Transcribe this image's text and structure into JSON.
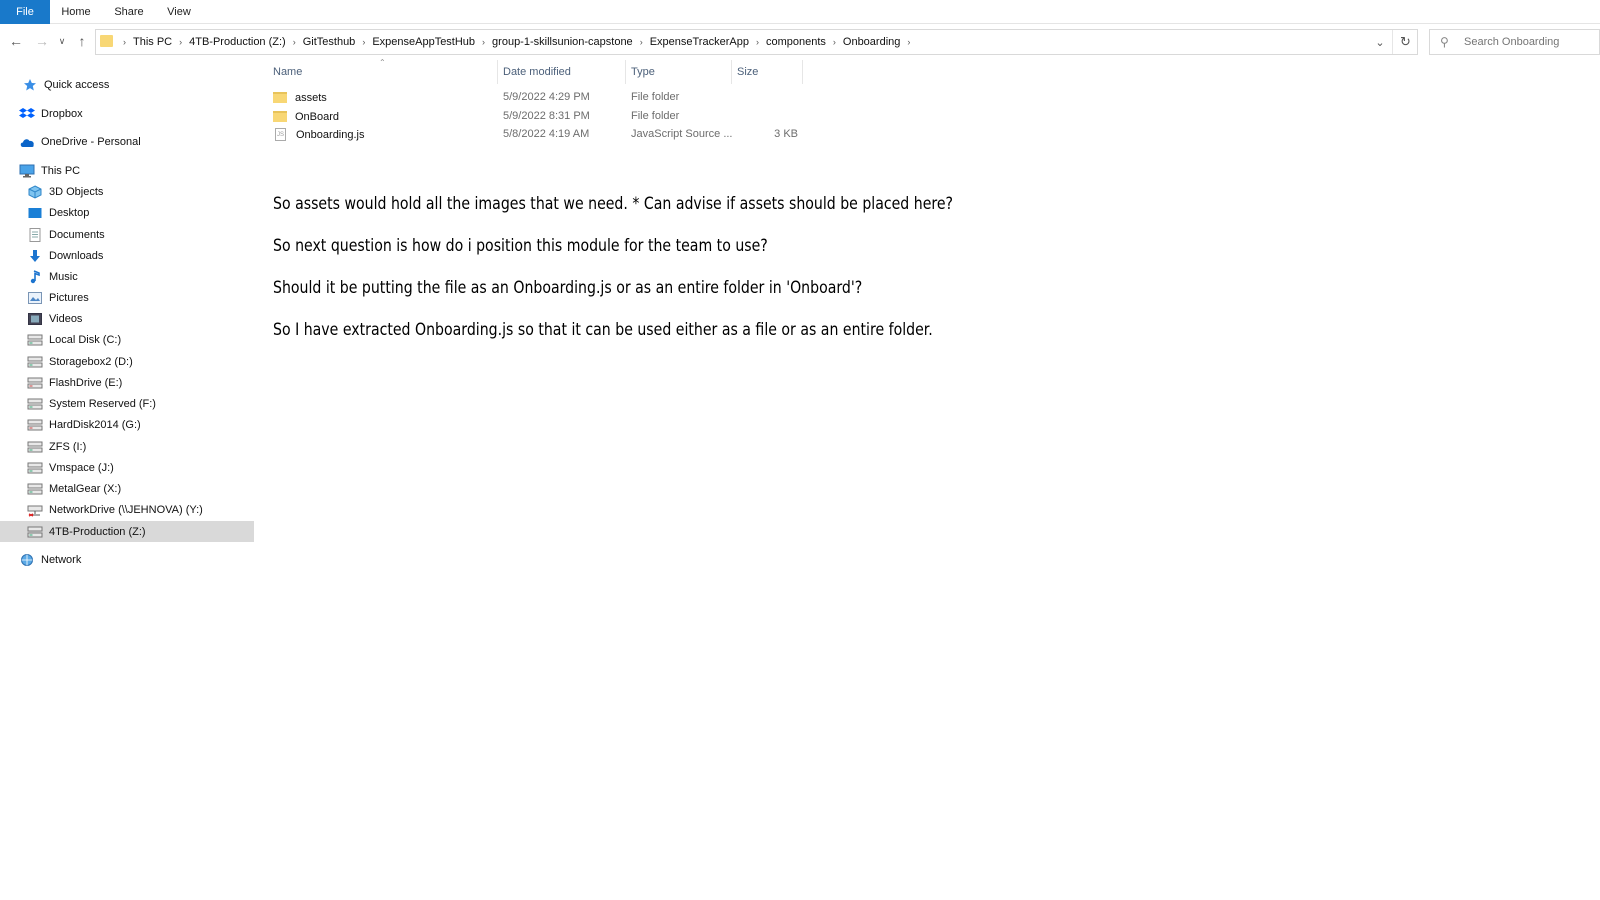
{
  "ribbon": {
    "tabs": [
      "File",
      "Home",
      "Share",
      "View"
    ]
  },
  "nav": {
    "back_icon": "arrow-left-icon",
    "forward_icon": "arrow-right-icon",
    "recent_icon": "chevron-down-icon",
    "up_icon": "arrow-up-icon"
  },
  "address": {
    "crumbs": [
      "This PC",
      "4TB-Production (Z:)",
      "GitTesthub",
      "ExpenseAppTestHub",
      "group-1-skillsunion-capstone",
      "ExpenseTrackerApp",
      "components",
      "Onboarding"
    ]
  },
  "search": {
    "placeholder": "Search Onboarding"
  },
  "sidebar": {
    "items": [
      {
        "label": "Quick access",
        "icon": "star-icon",
        "level": 0
      },
      {
        "label": "Dropbox",
        "icon": "dropbox-icon",
        "level": 0
      },
      {
        "label": "OneDrive - Personal",
        "icon": "cloud-icon",
        "level": 0
      },
      {
        "label": "This PC",
        "icon": "computer-icon",
        "level": 0
      },
      {
        "label": "3D Objects",
        "icon": "cube-icon",
        "level": 1
      },
      {
        "label": "Desktop",
        "icon": "desktop-icon",
        "level": 1
      },
      {
        "label": "Documents",
        "icon": "document-icon",
        "level": 1
      },
      {
        "label": "Downloads",
        "icon": "download-icon",
        "level": 1
      },
      {
        "label": "Music",
        "icon": "music-icon",
        "level": 1
      },
      {
        "label": "Pictures",
        "icon": "picture-icon",
        "level": 1
      },
      {
        "label": "Videos",
        "icon": "video-icon",
        "level": 1
      },
      {
        "label": "Local Disk (C:)",
        "icon": "drive-icon",
        "level": 1
      },
      {
        "label": "Storagebox2 (D:)",
        "icon": "drive-icon",
        "level": 1
      },
      {
        "label": "FlashDrive (E:)",
        "icon": "drive-icon",
        "level": 1
      },
      {
        "label": "System Reserved (F:)",
        "icon": "drive-icon",
        "level": 1
      },
      {
        "label": "HardDisk2014 (G:)",
        "icon": "drive-icon",
        "level": 1
      },
      {
        "label": "ZFS (I:)",
        "icon": "drive-icon",
        "level": 1
      },
      {
        "label": "Vmspace (J:)",
        "icon": "drive-icon",
        "level": 1
      },
      {
        "label": "MetalGear (X:)",
        "icon": "drive-icon",
        "level": 1
      },
      {
        "label": "NetworkDrive (\\\\JEHNOVA) (Y:)",
        "icon": "network-drive-icon",
        "level": 1
      },
      {
        "label": "4TB-Production (Z:)",
        "icon": "drive-icon",
        "level": 1,
        "selected": true
      },
      {
        "label": "Network",
        "icon": "network-icon",
        "level": 0
      }
    ]
  },
  "columns": {
    "name": "Name",
    "date": "Date modified",
    "type": "Type",
    "size": "Size"
  },
  "files": [
    {
      "name": "assets",
      "date": "5/9/2022 4:29 PM",
      "type": "File folder",
      "size": "",
      "icon": "folder-icon"
    },
    {
      "name": "OnBoard",
      "date": "5/9/2022 8:31 PM",
      "type": "File folder",
      "size": "",
      "icon": "folder-icon"
    },
    {
      "name": "Onboarding.js",
      "date": "5/8/2022 4:19 AM",
      "type": "JavaScript Source ...",
      "size": "3 KB",
      "icon": "js-file-icon"
    }
  ],
  "notes": [
    "So assets would hold all the images that we need. * Can advise if assets should be placed here?",
    "So next question is how do i position this module for the team to use?",
    "Should it be putting the file as an Onboarding.js or as an entire folder in 'Onboard'?",
    "So I have extracted Onboarding.js so that it can be used either as a file or as an entire folder."
  ],
  "colors": {
    "accent": "#1979ca",
    "folder": "#f8d775",
    "header_text": "#4c607a",
    "selection": "#d9d9d9"
  }
}
